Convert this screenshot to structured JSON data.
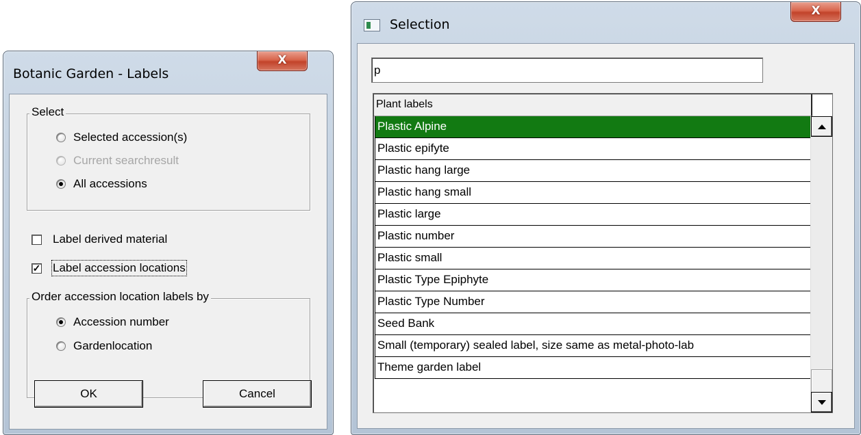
{
  "labels_dialog": {
    "title": "Botanic Garden - Labels",
    "close_label": "X",
    "select_group": {
      "title": "Select",
      "options": [
        {
          "label": "Selected accession(s)",
          "checked": false,
          "enabled": true
        },
        {
          "label": "Current searchresult",
          "checked": false,
          "enabled": false
        },
        {
          "label": "All accessions",
          "checked": true,
          "enabled": true
        }
      ]
    },
    "checkboxes": [
      {
        "label": "Label derived material",
        "checked": false
      },
      {
        "label": "Label accession locations",
        "checked": true
      }
    ],
    "order_group": {
      "title": "Order accession location labels by",
      "options": [
        {
          "label": "Accession number",
          "checked": true
        },
        {
          "label": "Gardenlocation",
          "checked": false
        }
      ]
    },
    "ok_label": "OK",
    "cancel_label": "Cancel"
  },
  "selection_dialog": {
    "title": "Selection",
    "close_label": "X",
    "search_value": "p",
    "column_header": "Plant labels",
    "selected_index": 0,
    "items": [
      "Plastic Alpine",
      "Plastic epifyte",
      "Plastic hang large",
      "Plastic hang small",
      "Plastic large",
      "Plastic number",
      "Plastic small",
      "Plastic Type Epiphyte",
      "Plastic Type Number",
      "Seed Bank",
      "Small (temporary) sealed label, size same as metal-photo-lab",
      "Theme garden  label"
    ]
  },
  "colors": {
    "selected_row_bg": "#127a12",
    "close_button": "#c2432a"
  }
}
